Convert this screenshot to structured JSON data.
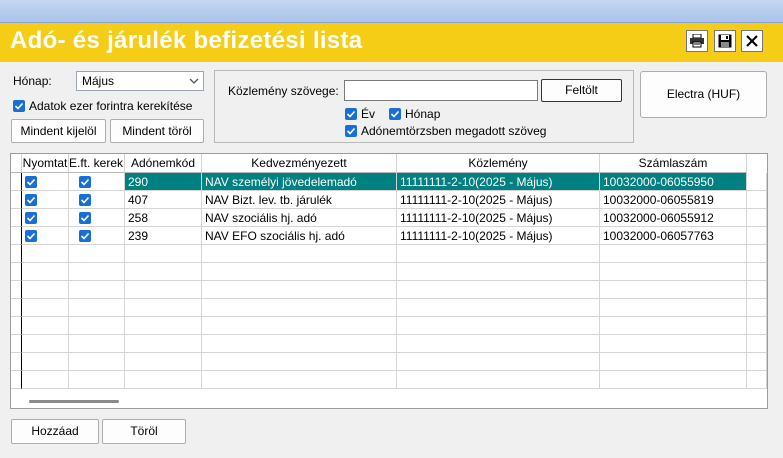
{
  "window": {
    "title": "Adó- és járulék befizetési lista"
  },
  "toolbar": {
    "print_icon": "printer-icon",
    "save_icon": "floppy-disk-icon",
    "close_icon": "close-x-icon"
  },
  "filters": {
    "month_label": "Hónap:",
    "month_value": "Május",
    "round_label": "Adatok ezer forintra kerekítése",
    "round_checked": true,
    "select_all_label": "Mindent kijelöl",
    "deselect_all_label": "Mindent töröl"
  },
  "comment": {
    "label": "Közlemény szövege:",
    "value": "",
    "upload_label": "Feltölt",
    "year_label": "Év",
    "year_checked": true,
    "month_label": "Hónap",
    "month_checked": true,
    "taxcode_label": "Adónemtörzsben megadott szöveg",
    "taxcode_checked": true
  },
  "electra_label": "Electra (HUF)",
  "grid": {
    "columns": [
      "Nyomtat",
      "E.ft. kerek.",
      "Adónemkód",
      "Kedvezményezett",
      "Közlemény",
      "Számlaszám"
    ],
    "rows": [
      {
        "print": true,
        "round": true,
        "code": "290",
        "beneficiary": "NAV személyi jövedelemadó",
        "comment": "11111111-2-10(2025 - Május)",
        "account": "10032000-06055950",
        "selected": true
      },
      {
        "print": true,
        "round": true,
        "code": "407",
        "beneficiary": "NAV Bizt. lev. tb. járulék",
        "comment": "11111111-2-10(2025 - Május)",
        "account": "10032000-06055819",
        "selected": false
      },
      {
        "print": true,
        "round": true,
        "code": "258",
        "beneficiary": "NAV szociális hj. adó",
        "comment": "11111111-2-10(2025 - Május)",
        "account": "10032000-06055912",
        "selected": false
      },
      {
        "print": true,
        "round": true,
        "code": "239",
        "beneficiary": "NAV EFO szociális hj. adó",
        "comment": "11111111-2-10(2025 - Május)",
        "account": "10032000-06057763",
        "selected": false
      }
    ],
    "selected_color": "#008080"
  },
  "footer": {
    "add_label": "Hozzáad",
    "delete_label": "Töröl"
  },
  "colors": {
    "title_bar": "#f5cd17",
    "checkbox": "#1a6fd6"
  }
}
